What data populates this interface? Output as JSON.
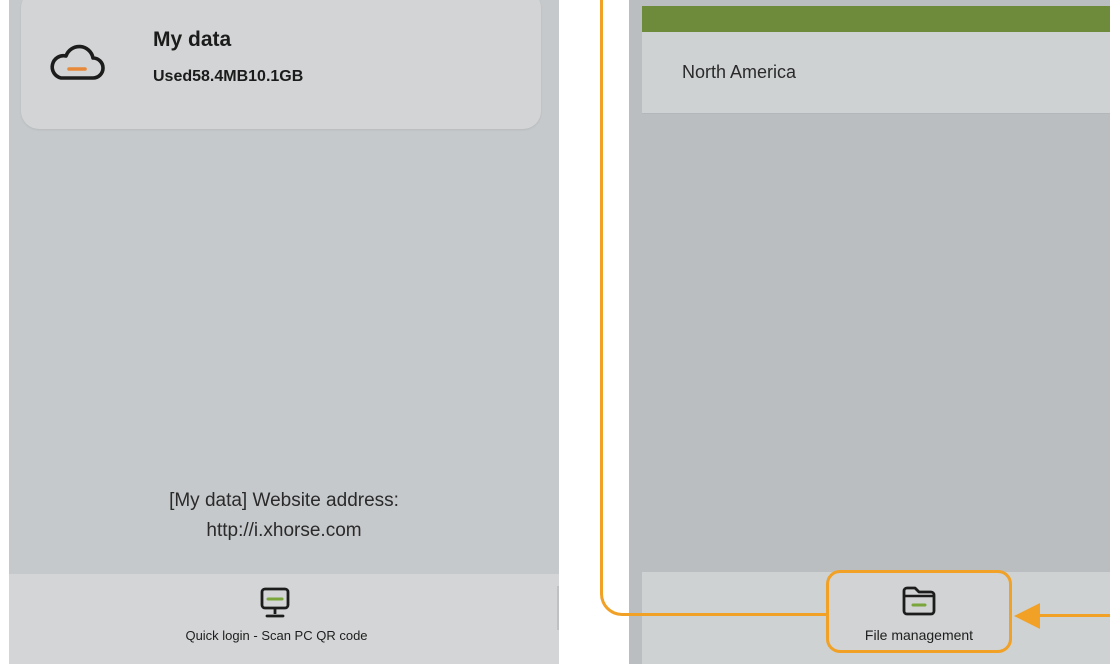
{
  "left_screen": {
    "card": {
      "icon": "cloud-icon",
      "title": "My data",
      "usage": "Used58.4MB10.1GB"
    },
    "website_note": {
      "line1": "[My data] Website address:",
      "line2": "http://i.xhorse.com"
    },
    "bottom_bar": {
      "icon": "monitor-icon",
      "label": "Quick login - Scan PC QR code"
    }
  },
  "right_screen": {
    "region_row": {
      "label": "North America"
    },
    "bottom_bar": {
      "icon": "folder-icon",
      "label": "File management"
    }
  },
  "colors": {
    "header_green": "#6e8a3b",
    "callout_orange": "#f0a126",
    "icon_accent": "#e8893a",
    "icon_green": "#7aa63b"
  }
}
